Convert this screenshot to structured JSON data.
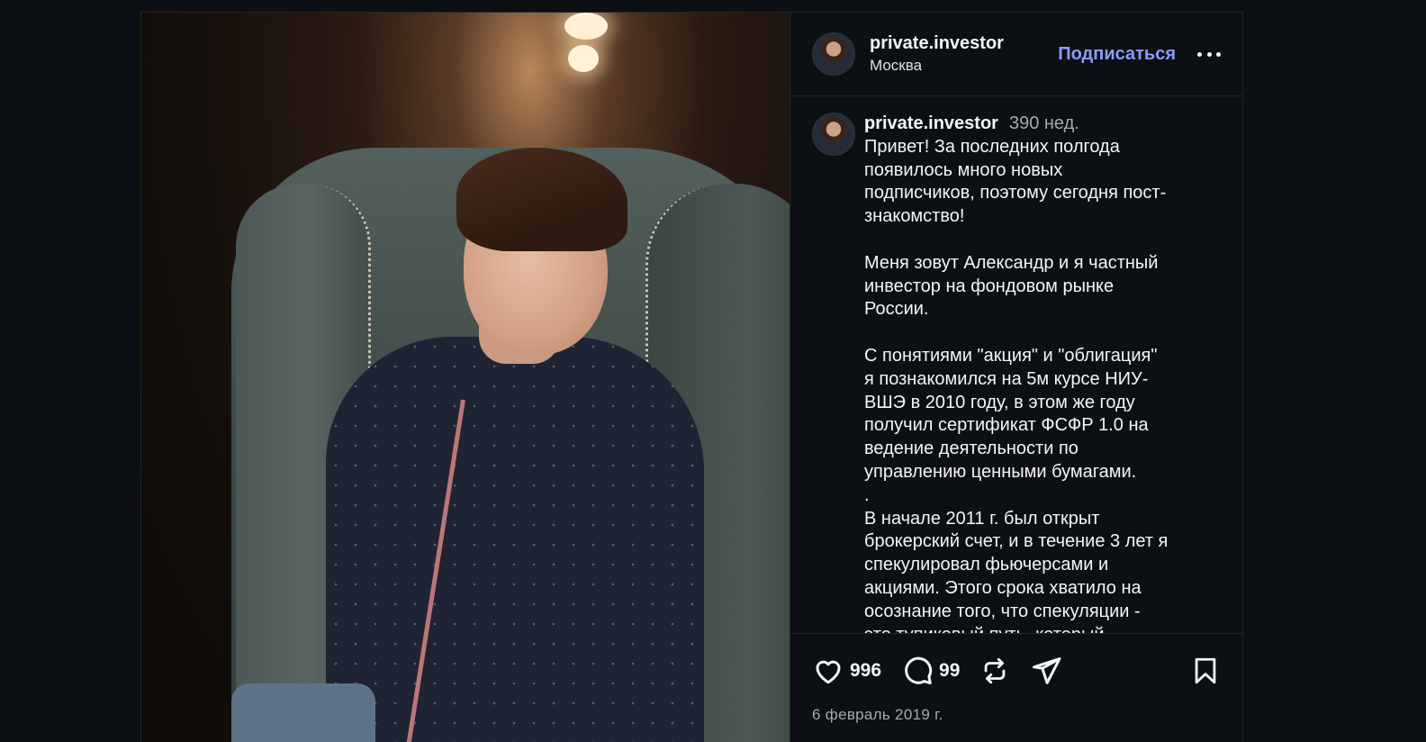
{
  "header": {
    "username": "private.investor",
    "location": "Москва",
    "follow_label": "Подписаться"
  },
  "caption": {
    "username": "private.investor",
    "time_ago": "390 нед.",
    "text": "Привет! За последних полгода\nпоявилось много новых\nподписчиков, поэтому сегодня пост-\nзнакомство!\n\nМеня зовут Александр и я частный\nинвестор на фондовом рынке\nРоссии.\n\nС понятиями \"акция\" и \"облигация\"\nя познакомился на 5м курсе НИУ-\nВШЭ в 2010 году, в этом же году\nполучил сертификат ФСФР 1.0 на\nведение деятельности по\nуправлению ценными бумагами.\n.\nВ начале 2011 г. был открыт\nброкерский счет, и в течение 3 лет я\nспекулировал фьючерсами и\nакциями. Этого срока хватило на\nосознание того, что спекуляции -\nэто тупиковый путь, который"
  },
  "actions": {
    "likes": "996",
    "comments": "99",
    "date": "6 февраль 2019 г."
  },
  "icons": {
    "like": "heart-icon",
    "comment": "comment-icon",
    "repost": "repost-icon",
    "share": "send-icon",
    "save": "bookmark-icon",
    "more": "more-icon"
  },
  "colors": {
    "background": "#0c1014",
    "accent": "#8a9bff",
    "muted": "#a8a8a8"
  }
}
